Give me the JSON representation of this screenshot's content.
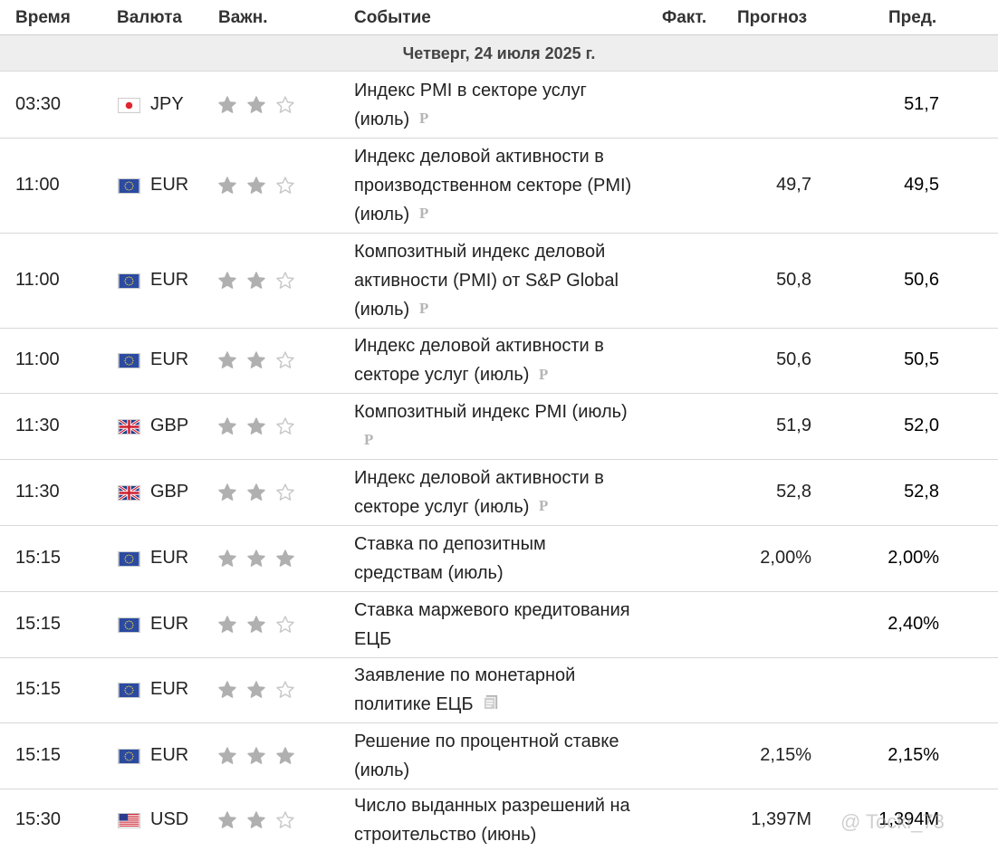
{
  "columns": {
    "time": "Время",
    "currency": "Валюта",
    "importance": "Важн.",
    "event": "Событие",
    "actual": "Факт.",
    "forecast": "Прогноз",
    "previous": "Пред."
  },
  "day_label": "Четверг, 24 июля 2025 г.",
  "rows": [
    {
      "time": "03:30",
      "currency": "JPY",
      "flag": "jp",
      "stars": 2,
      "event": "Индекс PMI в секторе услуг (июль)",
      "icon": "preliminary-icon",
      "actual": "",
      "forecast": "",
      "previous": "51,7"
    },
    {
      "time": "11:00",
      "currency": "EUR",
      "flag": "eu",
      "stars": 2,
      "event": "Индекс деловой активности в производственном секторе (PMI) (июль)",
      "icon": "preliminary-icon",
      "actual": "",
      "forecast": "49,7",
      "previous": "49,5"
    },
    {
      "time": "11:00",
      "currency": "EUR",
      "flag": "eu",
      "stars": 2,
      "event": "Композитный индекс деловой активности (PMI) от S&P Global (июль)",
      "icon": "preliminary-icon",
      "actual": "",
      "forecast": "50,8",
      "previous": "50,6"
    },
    {
      "time": "11:00",
      "currency": "EUR",
      "flag": "eu",
      "stars": 2,
      "event": "Индекс деловой активности в секторе услуг (июль)",
      "icon": "preliminary-icon",
      "actual": "",
      "forecast": "50,6",
      "previous": "50,5"
    },
    {
      "time": "11:30",
      "currency": "GBP",
      "flag": "gb",
      "stars": 2,
      "event": "Композитный индекс PMI (июль)",
      "icon": "preliminary-icon",
      "actual": "",
      "forecast": "51,9",
      "previous": "52,0"
    },
    {
      "time": "11:30",
      "currency": "GBP",
      "flag": "gb",
      "stars": 2,
      "event": "Индекс деловой активности в секторе услуг (июль)",
      "icon": "preliminary-icon",
      "actual": "",
      "forecast": "52,8",
      "previous": "52,8"
    },
    {
      "time": "15:15",
      "currency": "EUR",
      "flag": "eu",
      "stars": 3,
      "event": "Ставка по депозитным средствам (июль)",
      "icon": "",
      "actual": "",
      "forecast": "2,00%",
      "previous": "2,00%"
    },
    {
      "time": "15:15",
      "currency": "EUR",
      "flag": "eu",
      "stars": 2,
      "event": "Ставка маржевого кредитования ЕЦБ",
      "icon": "",
      "actual": "",
      "forecast": "",
      "previous": "2,40%"
    },
    {
      "time": "15:15",
      "currency": "EUR",
      "flag": "eu",
      "stars": 2,
      "event": "Заявление по монетарной политике ЕЦБ",
      "icon": "document-icon",
      "actual": "",
      "forecast": "",
      "previous": ""
    },
    {
      "time": "15:15",
      "currency": "EUR",
      "flag": "eu",
      "stars": 3,
      "event": "Решение по процентной ставке (июль)",
      "icon": "",
      "actual": "",
      "forecast": "2,15%",
      "previous": "2,15%"
    },
    {
      "time": "15:30",
      "currency": "USD",
      "flag": "us",
      "stars": 2,
      "event": "Число выданных разрешений на строительство (июнь)",
      "icon": "",
      "actual": "",
      "forecast": "1,397M",
      "previous": "1,394M"
    }
  ],
  "watermark": "@ Tocki_73",
  "colors": {
    "star_filled": "#b0b0b0",
    "star_empty": "#c8c8c8",
    "day_bg": "#eeeeee"
  }
}
